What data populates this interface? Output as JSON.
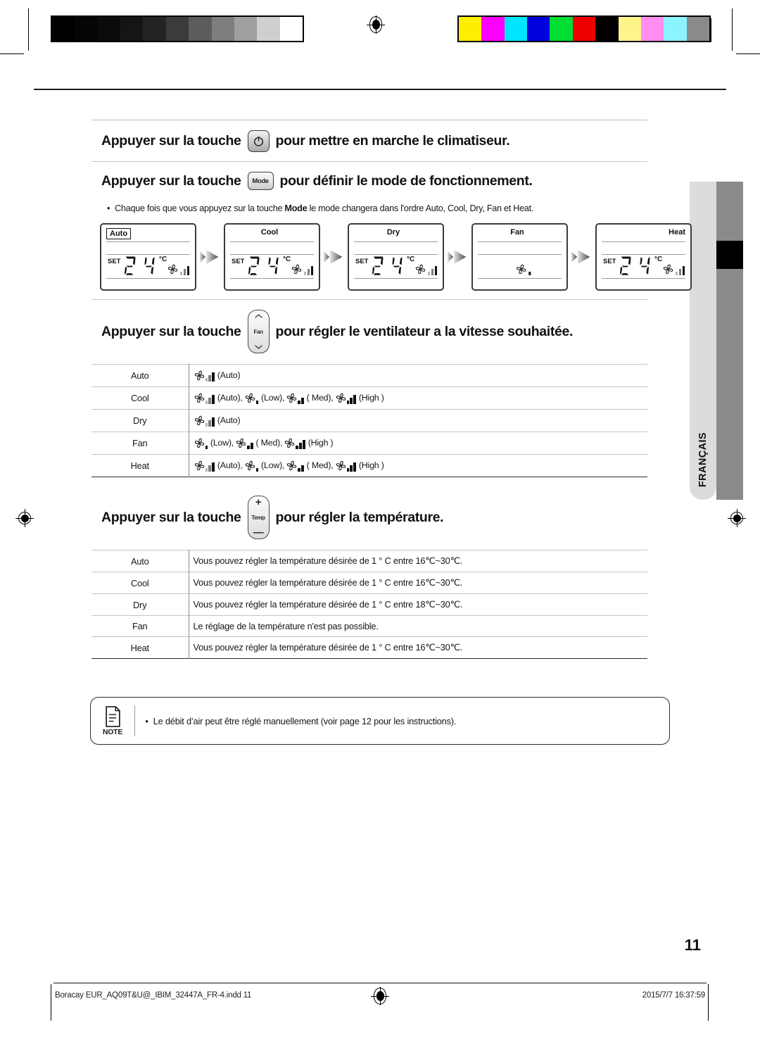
{
  "document": {
    "page_number": "11",
    "language_tab": "FRANÇAIS",
    "footer_file": "Boracay EUR_AQ09T&U@_IBIM_32447A_FR-4.indd   11",
    "footer_timestamp": "2015/7/7   16:37:59"
  },
  "sections": {
    "power": {
      "text_before": "Appuyer sur la touche",
      "button_label": "power-symbol",
      "text_after": "pour mettre en marche le climatiseur."
    },
    "mode": {
      "text_before": "Appuyer sur la touche",
      "button_label": "Mode",
      "text_after": "pour définir le mode de fonctionnement.",
      "bullet": {
        "before": "Chaque fois que vous appuyez sur la touche ",
        "bold": "Mode",
        "after": " le mode changera dans l'ordre Auto, Cool, Dry, Fan et Heat."
      },
      "displays": [
        {
          "mode": "Auto",
          "selected": true,
          "align": "left",
          "show_temp": true,
          "set_label": "SET",
          "temperature": "24",
          "unit": "°C",
          "fan_bars": "auto"
        },
        {
          "mode": "Cool",
          "selected": false,
          "align": "center",
          "show_temp": true,
          "set_label": "SET",
          "temperature": "24",
          "unit": "°C",
          "fan_bars": "auto"
        },
        {
          "mode": "Dry",
          "selected": false,
          "align": "center",
          "show_temp": true,
          "set_label": "SET",
          "temperature": "24",
          "unit": "°C",
          "fan_bars": "auto"
        },
        {
          "mode": "Fan",
          "selected": false,
          "align": "center",
          "show_temp": false,
          "set_label": "",
          "temperature": "",
          "unit": "",
          "fan_bars": "low"
        },
        {
          "mode": "Heat",
          "selected": false,
          "align": "right",
          "show_temp": true,
          "set_label": "SET",
          "temperature": "24",
          "unit": "°C",
          "fan_bars": "auto"
        }
      ]
    },
    "fan": {
      "text_before": "Appuyer sur la touche",
      "button_label": "Fan",
      "text_after": "pour régler le ventilateur a la vitesse souhaitée.",
      "rows": [
        {
          "mode": "Auto",
          "options": [
            {
              "bars": "auto",
              "label": "(Auto)"
            }
          ]
        },
        {
          "mode": "Cool",
          "options": [
            {
              "bars": "auto",
              "label": "(Auto),"
            },
            {
              "bars": "low",
              "label": "(Low),"
            },
            {
              "bars": "med",
              "label": "( Med),"
            },
            {
              "bars": "high",
              "label": "(High )"
            }
          ]
        },
        {
          "mode": "Dry",
          "options": [
            {
              "bars": "auto",
              "label": "(Auto)"
            }
          ]
        },
        {
          "mode": "Fan",
          "options": [
            {
              "bars": "low",
              "label": "(Low),"
            },
            {
              "bars": "med",
              "label": "( Med),"
            },
            {
              "bars": "high",
              "label": "(High )"
            }
          ]
        },
        {
          "mode": "Heat",
          "options": [
            {
              "bars": "auto",
              "label": "(Auto),"
            },
            {
              "bars": "low",
              "label": "(Low),"
            },
            {
              "bars": "med",
              "label": "( Med),"
            },
            {
              "bars": "high",
              "label": "(High )"
            }
          ]
        }
      ]
    },
    "temperature": {
      "text_before": "Appuyer sur la touche",
      "button_label": "Temp",
      "button_plus": "+",
      "button_minus": "—",
      "text_after": "pour régler la température.",
      "rows": [
        {
          "mode": "Auto",
          "description": "Vous pouvez régler la température désirée de 1 ° C entre 16℃~30℃."
        },
        {
          "mode": "Cool",
          "description": "Vous pouvez régler la température désirée de 1 ° C entre 16℃~30℃."
        },
        {
          "mode": "Dry",
          "description": "Vous pouvez régler la température désirée de 1 ° C entre 18℃~30℃."
        },
        {
          "mode": "Fan",
          "description": "Le réglage de la température n'est pas possible."
        },
        {
          "mode": "Heat",
          "description": "Vous pouvez régler la température désirée de 1 ° C entre 16℃~30℃."
        }
      ]
    },
    "note": {
      "label": "NOTE",
      "text": "Le débit d’air peut être réglé manuellement (voir page 12 pour les instructions)."
    }
  },
  "calibration": {
    "grayscale": [
      "#000000",
      "#050505",
      "#0b0b0b",
      "#151515",
      "#232323",
      "#3b3b3b",
      "#5c5c5c",
      "#7e7e7e",
      "#9f9f9f",
      "#cfcfcf",
      "#ffffff"
    ],
    "colors": [
      "#ffee00",
      "#ff00ff",
      "#00e5ff",
      "#0000dd",
      "#00dd33",
      "#ee0000",
      "#000000",
      "#fff48a",
      "#ff8ef0",
      "#8bf4ff",
      "#8a8a8a"
    ]
  }
}
